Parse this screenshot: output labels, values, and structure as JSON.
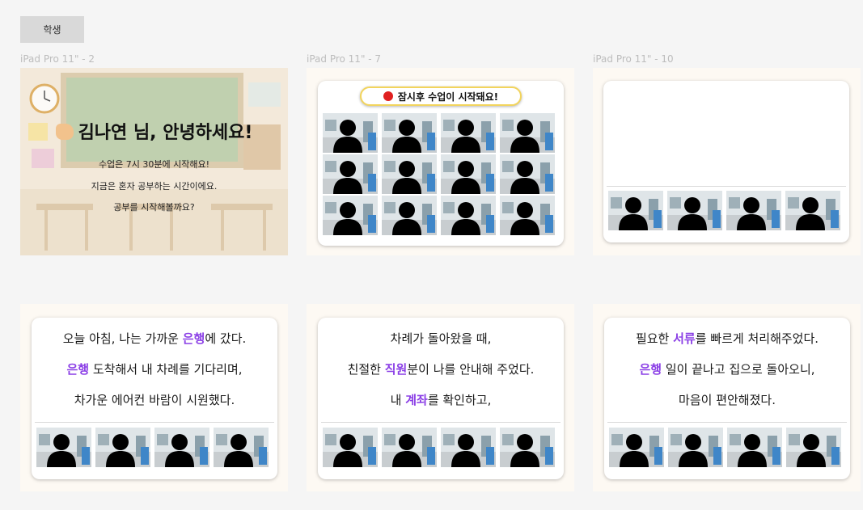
{
  "tag": {
    "label": "학생"
  },
  "frames": {
    "f1": {
      "label": "iPad Pro 11\" - 2"
    },
    "f2": {
      "label": "iPad Pro 11\" - 7"
    },
    "f3": {
      "label": "iPad Pro 11\" - 10"
    }
  },
  "greeting": {
    "hand_icon": "waving-hand",
    "title": "김나연 님, 안녕하세요!",
    "line1": "수업은 7시 30분에 시작해요!",
    "line2": "지금은 혼자 공부하는 시간이에요.",
    "line3": "공부를 시작해볼까요?"
  },
  "notice": {
    "text": "잠시후 수업이 시작돼요!",
    "dot_color": "#e02020"
  },
  "stories": [
    {
      "lines": [
        [
          {
            "t": "오늘 아침, 나는 가까운 "
          },
          {
            "t": "은행",
            "hl": true
          },
          {
            "t": "에 갔다."
          }
        ],
        [
          {
            "t": "은행",
            "hl": true
          },
          {
            "t": " 도착해서 내 차례를 기다리며,"
          }
        ],
        [
          {
            "t": "차가운 에어컨 바람이 시원했다."
          }
        ]
      ]
    },
    {
      "lines": [
        [
          {
            "t": "차례가 돌아왔을 때,"
          }
        ],
        [
          {
            "t": "친절한 "
          },
          {
            "t": "직원",
            "hl": true
          },
          {
            "t": "분이 나를 안내해 주었다."
          }
        ],
        [
          {
            "t": "내 "
          },
          {
            "t": "계좌",
            "hl": true
          },
          {
            "t": "를 확인하고,"
          }
        ]
      ]
    },
    {
      "lines": [
        [
          {
            "t": "필요한 "
          },
          {
            "t": "서류",
            "hl": true
          },
          {
            "t": "를 빠르게 처리해주었다."
          }
        ],
        [
          {
            "t": "은행",
            "hl": true
          },
          {
            "t": " 일이 끝나고 집으로 돌아오니,"
          }
        ],
        [
          {
            "t": "마음이 편안해졌다."
          }
        ]
      ]
    }
  ],
  "colors": {
    "highlight": "#8b3fe6",
    "frame_bg": "#fdf9f3",
    "notice_border": "#f2d45c"
  },
  "icons": {
    "participant": "person-silhouette-icon",
    "clock": "wall-clock-icon"
  }
}
